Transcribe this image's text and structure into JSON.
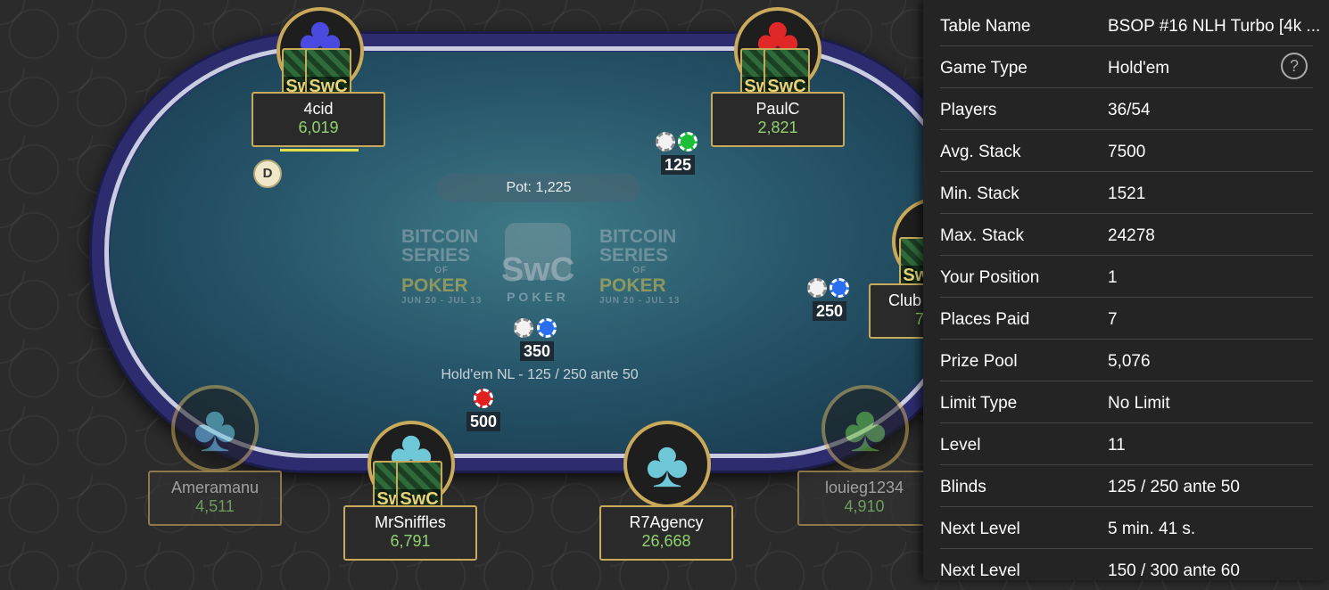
{
  "table": {
    "pot_label": "Pot: 1,225",
    "game_desc": "Hold'em NL - 125 / 250 ante 50",
    "dealer_label": "D",
    "logo": {
      "series_line1": "BITCOIN",
      "series_line2": "SERIES",
      "series_of": "OF",
      "series_line3": "POKER",
      "series_dates": "JUN 20 - JUL 13",
      "swc_text": "SwC",
      "swc_sub": "POKER"
    },
    "card_back_text": "SwC",
    "seats": [
      {
        "name": "4cid",
        "stack": "6,019",
        "club_color": "#4a4ae0",
        "active": true,
        "has_cards": true
      },
      {
        "name": "PaulC",
        "stack": "2,821",
        "club_color": "#e02828",
        "active": true,
        "has_cards": true
      },
      {
        "name": "Club",
        "stack": "7",
        "club_color": "#3a9a8a",
        "active": true,
        "has_cards": true
      },
      {
        "name": "louieg1234",
        "stack": "4,910",
        "club_color": "#6ac040",
        "active": false,
        "has_cards": false
      },
      {
        "name": "R7Agency",
        "stack": "26,668",
        "club_color": "#6ec8d8",
        "active": true,
        "has_cards": false
      },
      {
        "name": "MrSniffles",
        "stack": "6,791",
        "club_color": "#6ec8d8",
        "active": true,
        "has_cards": true
      },
      {
        "name": "Ameramanu",
        "stack": "4,511",
        "club_color": "#6ec8d8",
        "active": false,
        "has_cards": false
      }
    ],
    "bets": [
      {
        "value": "125",
        "chips": [
          "white",
          "green"
        ]
      },
      {
        "value": "250",
        "chips": [
          "white",
          "blue"
        ]
      },
      {
        "value": "350",
        "chips": [
          "white",
          "blue"
        ]
      },
      {
        "value": "500",
        "chips": [
          "red"
        ]
      }
    ]
  },
  "info_panel": {
    "rows": [
      {
        "key": "Table Name",
        "value": "BSOP #16 NLH Turbo [4k ..."
      },
      {
        "key": "Game Type",
        "value": "Hold'em"
      },
      {
        "key": "Players",
        "value": "36/54"
      },
      {
        "key": "Avg. Stack",
        "value": "7500"
      },
      {
        "key": "Min. Stack",
        "value": "1521"
      },
      {
        "key": "Max. Stack",
        "value": "24278"
      },
      {
        "key": "Your Position",
        "value": "1"
      },
      {
        "key": "Places Paid",
        "value": "7"
      },
      {
        "key": "Prize Pool",
        "value": "5,076"
      },
      {
        "key": "Limit Type",
        "value": "No Limit"
      },
      {
        "key": "Level",
        "value": "11"
      },
      {
        "key": "Blinds",
        "value": "125 / 250 ante 50"
      },
      {
        "key": "Next Level",
        "value": "5 min. 41 s."
      },
      {
        "key": "Next Level",
        "value": "150 / 300 ante 60"
      }
    ],
    "help_label": "?"
  }
}
